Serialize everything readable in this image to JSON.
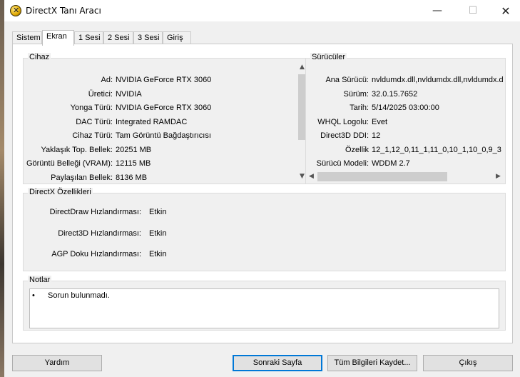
{
  "window": {
    "title": "DirectX Tanı Aracı",
    "minimize_icon": "—",
    "maximize_icon": "☐",
    "close_icon": "✕"
  },
  "tabs": [
    {
      "label": "Sistem",
      "active": false
    },
    {
      "label": "Ekran",
      "active": true
    },
    {
      "label": "1 Sesi",
      "active": false
    },
    {
      "label": "2 Sesi",
      "active": false
    },
    {
      "label": "3 Sesi",
      "active": false
    },
    {
      "label": "Giriş",
      "active": false
    }
  ],
  "device": {
    "title": "Cihaz",
    "rows": [
      {
        "label": "Ad:",
        "value": "NVIDIA GeForce RTX 3060"
      },
      {
        "label": "Üretici:",
        "value": "NVIDIA"
      },
      {
        "label": "Yonga Türü:",
        "value": "NVIDIA GeForce RTX 3060"
      },
      {
        "label": "DAC Türü:",
        "value": "Integrated RAMDAC"
      },
      {
        "label": "Cihaz Türü:",
        "value": "Tam Görüntü Bağdaştırıcısı"
      },
      {
        "label": "Yaklaşık Top. Bellek:",
        "value": "20251 MB"
      },
      {
        "label": "Görüntü Belleği (VRAM):",
        "value": "12115 MB"
      },
      {
        "label": "Paylaşılan Bellek:",
        "value": "8136 MB"
      }
    ]
  },
  "drivers": {
    "title": "Sürücüler",
    "rows": [
      {
        "label": "Ana Sürücü:",
        "value": "nvldumdx.dll,nvldumdx.dll,nvldumdx.d"
      },
      {
        "label": "Sürüm:",
        "value": "32.0.15.7652"
      },
      {
        "label": "Tarih:",
        "value": "5/14/2025 03:00:00"
      },
      {
        "label": "WHQL Logolu:",
        "value": "Evet"
      },
      {
        "label": "Direct3D DDI:",
        "value": "12"
      },
      {
        "label": "Özellik",
        "value": "12_1,12_0,11_1,11_0,10_1,10_0,9_3"
      },
      {
        "label": "Sürücü Modeli:",
        "value": "WDDM 2.7"
      }
    ]
  },
  "features": {
    "title": "DirectX Özellikleri",
    "rows": [
      {
        "label": "DirectDraw Hızlandırması:",
        "value": "Etkin"
      },
      {
        "label": "Direct3D Hızlandırması:",
        "value": "Etkin"
      },
      {
        "label": "AGP Doku Hızlandırması:",
        "value": "Etkin"
      }
    ]
  },
  "notes": {
    "title": "Notlar",
    "bullet": "•",
    "items": [
      "Sorun bulunmadı."
    ]
  },
  "buttons": {
    "help": "Yardım",
    "next_page": "Sonraki Sayfa",
    "save_all": "Tüm Bilgileri Kaydet...",
    "exit": "Çıkış"
  },
  "icons": {
    "app": "directx-icon",
    "scroll_up": "▲",
    "scroll_down": "▼",
    "scroll_left": "◀",
    "scroll_right": "▶"
  },
  "colors": {
    "window_bg": "#f0f0f0",
    "panel_bg": "#ffffff",
    "default_button_border": "#0078d7"
  }
}
